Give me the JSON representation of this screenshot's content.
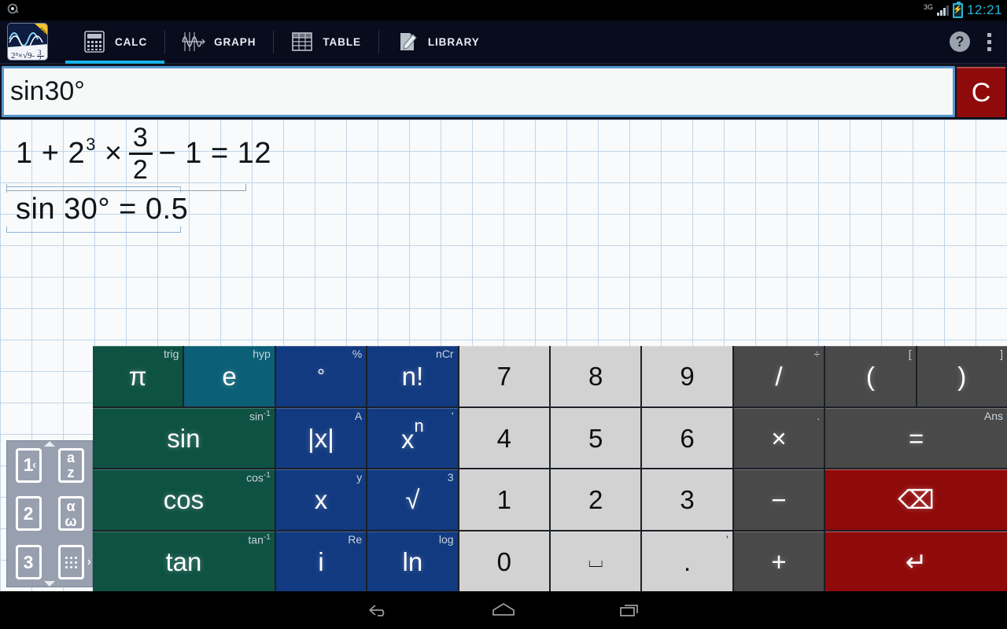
{
  "status_bar": {
    "notification_icon": "notification-dot-icon",
    "network_label": "3G",
    "signal_icon": "signal-bars-icon",
    "battery_icon": "battery-charging-icon",
    "time": "12:21"
  },
  "action_bar": {
    "app_logo": "graphing-calculator-logo",
    "tabs": [
      {
        "label": "CALC",
        "icon": "calculator-icon",
        "active": true
      },
      {
        "label": "GRAPH",
        "icon": "waveform-icon",
        "active": false
      },
      {
        "label": "TABLE",
        "icon": "table-grid-icon",
        "active": false
      },
      {
        "label": "LIBRARY",
        "icon": "document-pencil-icon",
        "active": false
      }
    ],
    "help_label": "?",
    "overflow_icon": "overflow-menu-icon",
    "accent_color": "#18b4e9"
  },
  "input": {
    "value": "sin30°",
    "placeholder": "",
    "clear_label": "C",
    "clear_color": "#8f0a0a",
    "focus_border_color": "#5498cf"
  },
  "history": [
    {
      "id": "entry-1",
      "parts": [
        {
          "t": "text",
          "v": "1 + 2"
        },
        {
          "t": "sup",
          "v": "3"
        },
        {
          "t": "text",
          "v": "×"
        },
        {
          "t": "frac",
          "num": "3",
          "den": "2"
        },
        {
          "t": "text",
          "v": "− 1 = 12"
        }
      ],
      "plain": "1 + 2^3 × 3/2 − 1 = 12",
      "selected": false
    },
    {
      "id": "entry-2",
      "parts": [
        {
          "t": "text",
          "v": "sin 30° = 0.5"
        }
      ],
      "plain": "sin 30° = 0.5",
      "selected": true
    }
  ],
  "keypad_selector": {
    "items": [
      {
        "name": "keypad-1",
        "label": "1"
      },
      {
        "name": "keypad-az",
        "label": "a\nz",
        "top": "a",
        "bottom": "z"
      },
      {
        "name": "keypad-2",
        "label": "2"
      },
      {
        "name": "keypad-greek",
        "top": "α",
        "bottom": "ω"
      },
      {
        "name": "keypad-3",
        "label": "3"
      },
      {
        "name": "keypad-dots",
        "icon": "braille-dots-icon"
      }
    ],
    "chevron_left": "‹",
    "chevron_right": "›"
  },
  "keypad": {
    "rows": [
      [
        {
          "main": "π",
          "corner": "trig",
          "style": "k-green"
        },
        {
          "main": "e",
          "corner": "hyp",
          "style": "k-teal"
        },
        {
          "main": "°",
          "corner": "%",
          "style": "k-blue",
          "size": "small"
        },
        {
          "main": "n!",
          "corner": "nCr",
          "style": "k-blue"
        },
        {
          "main": "7",
          "corner": "",
          "style": "k-num"
        },
        {
          "main": "8",
          "corner": "",
          "style": "k-num"
        },
        {
          "main": "9",
          "corner": "",
          "style": "k-num"
        },
        {
          "main": "/",
          "corner": "÷",
          "style": "k-op"
        },
        {
          "main": "(",
          "corner": "[",
          "style": "k-op"
        },
        {
          "main": ")",
          "corner": "]",
          "style": "k-op"
        }
      ],
      [
        {
          "main": "sin",
          "corner": "sin-1",
          "style": "k-green",
          "span": 2
        },
        {
          "main": "|x|",
          "corner": "A",
          "style": "k-blue"
        },
        {
          "main": "x^n",
          "corner": "'",
          "style": "k-blue"
        },
        {
          "main": "4",
          "corner": "",
          "style": "k-num"
        },
        {
          "main": "5",
          "corner": "",
          "style": "k-num"
        },
        {
          "main": "6",
          "corner": "",
          "style": "k-num"
        },
        {
          "main": "×",
          "corner": ".",
          "style": "k-op"
        },
        {
          "main": "=",
          "corner": "Ans",
          "style": "k-op",
          "span": 2
        }
      ],
      [
        {
          "main": "cos",
          "corner": "cos-1",
          "style": "k-green",
          "span": 2
        },
        {
          "main": "x",
          "corner": "y",
          "style": "k-blue"
        },
        {
          "main": "√",
          "corner": "3",
          "style": "k-blue"
        },
        {
          "main": "1",
          "corner": "",
          "style": "k-num"
        },
        {
          "main": "2",
          "corner": "",
          "style": "k-num"
        },
        {
          "main": "3",
          "corner": "",
          "style": "k-num"
        },
        {
          "main": "−",
          "corner": "",
          "style": "k-op"
        },
        {
          "main": "⌫",
          "corner": "",
          "style": "k-red",
          "span": 2
        }
      ],
      [
        {
          "main": "tan",
          "corner": "tan-1",
          "style": "k-green",
          "span": 2
        },
        {
          "main": "i",
          "corner": "Re",
          "style": "k-blue"
        },
        {
          "main": "ln",
          "corner": "log",
          "style": "k-blue"
        },
        {
          "main": "0",
          "corner": "",
          "style": "k-num"
        },
        {
          "main": "⌴",
          "corner": "",
          "style": "k-num",
          "size": "small"
        },
        {
          "main": ".",
          "corner": "'",
          "style": "k-num"
        },
        {
          "main": "+",
          "corner": "",
          "style": "k-op"
        },
        {
          "main": "↵",
          "corner": "",
          "style": "k-red",
          "span": 2
        }
      ]
    ]
  },
  "nav_bar": {
    "back": "back-icon",
    "home": "home-icon",
    "recents": "recents-icon"
  }
}
